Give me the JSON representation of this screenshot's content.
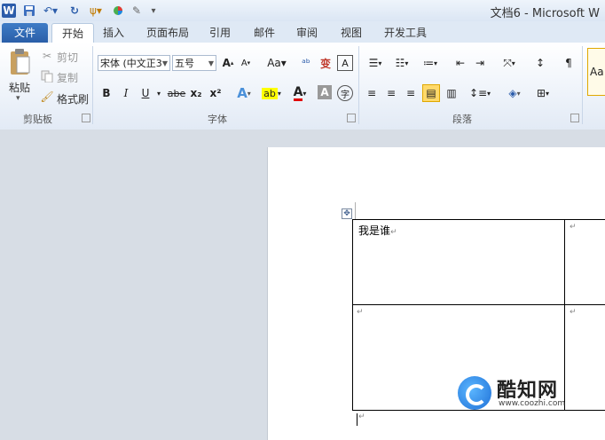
{
  "titlebar": {
    "title": "文档6 - Microsoft W",
    "qat": [
      "word-icon",
      "save-icon",
      "undo-icon",
      "redo-icon",
      "format-icon",
      "color-icon",
      "pen-icon",
      "customize-icon"
    ]
  },
  "tabs": [
    {
      "label": "文件"
    },
    {
      "label": "开始"
    },
    {
      "label": "插入"
    },
    {
      "label": "页面布局"
    },
    {
      "label": "引用"
    },
    {
      "label": "邮件"
    },
    {
      "label": "审阅"
    },
    {
      "label": "视图"
    },
    {
      "label": "开发工具"
    }
  ],
  "clipboard": {
    "paste_label": "粘贴",
    "cut_label": "剪切",
    "copy_label": "复制",
    "format_painter_label": "格式刷",
    "group_label": "剪贴板"
  },
  "font": {
    "font_name": "宋体 (中文正3",
    "font_size": "五号",
    "group_label": "字体",
    "buttons": [
      "B",
      "I",
      "U",
      "abe",
      "x₂",
      "x²"
    ]
  },
  "paragraph": {
    "group_label": "段落"
  },
  "styles": {
    "preview": "Aa"
  },
  "document": {
    "cell_text": "我是谁",
    "para_mark": "↵"
  },
  "watermark": {
    "name": "酷知网",
    "url": "www.coozhi.com"
  }
}
